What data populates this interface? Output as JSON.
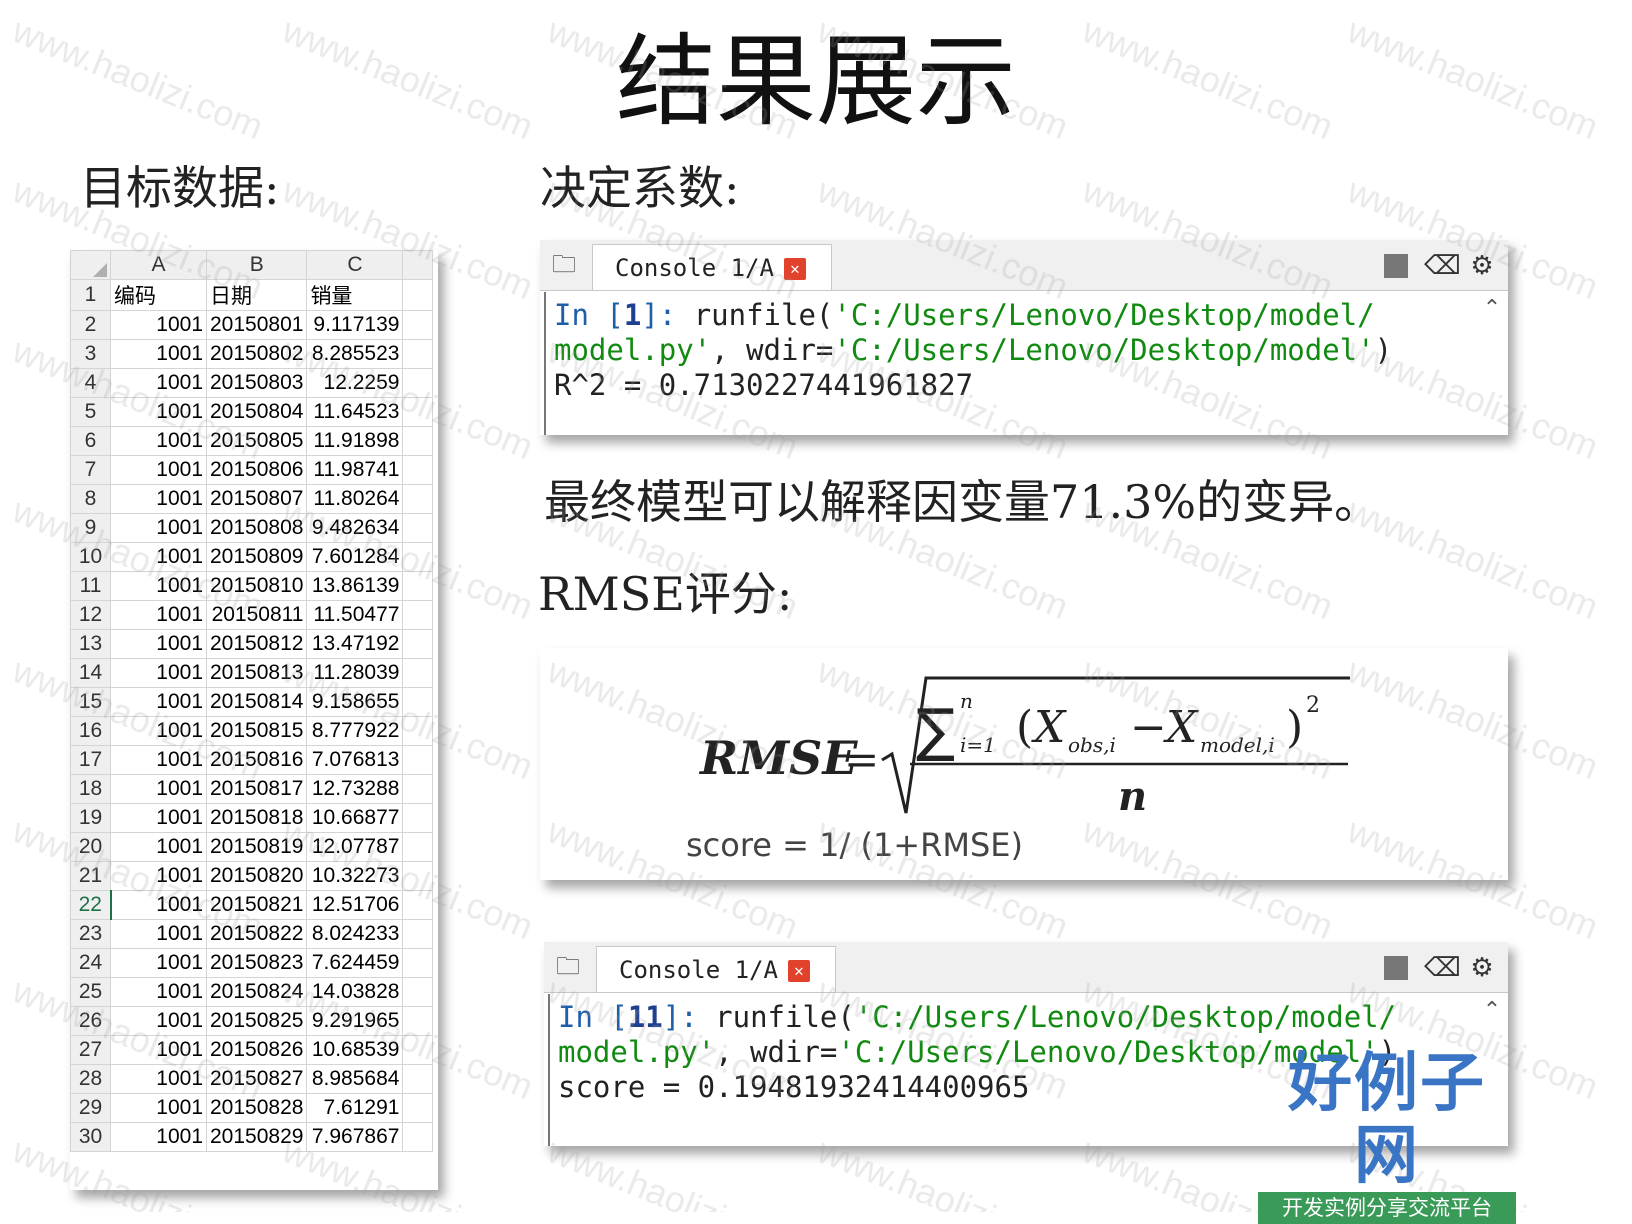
{
  "title": "结果展示",
  "headings": {
    "target_data": "目标数据:",
    "r2": "决定系数:",
    "explain": "最终模型可以解释因变量71.3%的变异。",
    "rmse": "RMSE评分:"
  },
  "sheet": {
    "col_headers": [
      "A",
      "B",
      "C"
    ],
    "header_row": [
      "编码",
      "日期",
      "销量"
    ],
    "selected_row": "22",
    "rows": [
      [
        "1001",
        "20150801",
        "9.117139"
      ],
      [
        "1001",
        "20150802",
        "8.285523"
      ],
      [
        "1001",
        "20150803",
        "12.2259"
      ],
      [
        "1001",
        "20150804",
        "11.64523"
      ],
      [
        "1001",
        "20150805",
        "11.91898"
      ],
      [
        "1001",
        "20150806",
        "11.98741"
      ],
      [
        "1001",
        "20150807",
        "11.80264"
      ],
      [
        "1001",
        "20150808",
        "9.482634"
      ],
      [
        "1001",
        "20150809",
        "7.601284"
      ],
      [
        "1001",
        "20150810",
        "13.86139"
      ],
      [
        "1001",
        "20150811",
        "11.50477"
      ],
      [
        "1001",
        "20150812",
        "13.47192"
      ],
      [
        "1001",
        "20150813",
        "11.28039"
      ],
      [
        "1001",
        "20150814",
        "9.158655"
      ],
      [
        "1001",
        "20150815",
        "8.777922"
      ],
      [
        "1001",
        "20150816",
        "7.076813"
      ],
      [
        "1001",
        "20150817",
        "12.73288"
      ],
      [
        "1001",
        "20150818",
        "10.66877"
      ],
      [
        "1001",
        "20150819",
        "12.07787"
      ],
      [
        "1001",
        "20150820",
        "10.32273"
      ],
      [
        "1001",
        "20150821",
        "12.51706"
      ],
      [
        "1001",
        "20150822",
        "8.024233"
      ],
      [
        "1001",
        "20150823",
        "7.624459"
      ],
      [
        "1001",
        "20150824",
        "14.03828"
      ],
      [
        "1001",
        "20150825",
        "9.291965"
      ],
      [
        "1001",
        "20150826",
        "10.68539"
      ],
      [
        "1001",
        "20150827",
        "8.985684"
      ],
      [
        "1001",
        "20150828",
        "7.61291"
      ],
      [
        "1001",
        "20150829",
        "7.967867"
      ]
    ]
  },
  "console1": {
    "tab_label": "Console 1/A",
    "prompt_in": "In [",
    "prompt_num": "1",
    "prompt_end": "]: ",
    "fn": "runfile(",
    "path1": "'C:/Users/Lenovo/Desktop/model/",
    "path2": "model.py'",
    "mid": ", wdir=",
    "dir": "'C:/Users/Lenovo/Desktop/model'",
    "close": ")",
    "result": "R^2 = 0.7130227441961827"
  },
  "console2": {
    "tab_label": "Console 1/A",
    "prompt_in": "In [",
    "prompt_num": "11",
    "prompt_end": "]: ",
    "fn": "runfile(",
    "path1": "'C:/Users/Lenovo/Desktop/model/",
    "path2": "model.py'",
    "mid": ", wdir=",
    "dir": "'C:/Users/Lenovo/Desktop/model'",
    "close": ")",
    "result": "score = 0.19481932414400965"
  },
  "formula": {
    "lhs": "RMSE",
    "eq": "=",
    "sum_upper": "n",
    "sum_lower": "i=1",
    "x_obs": "X",
    "obs_sub": "obs,i",
    "x_model": "X",
    "model_sub": "model,i",
    "power": "2",
    "denominator": "n",
    "score_line": "score = 1/ (1+RMSE)"
  },
  "logo": {
    "main": "好例子网",
    "sub": "开发实例分享交流平台"
  },
  "watermark": "www.haolizi.com",
  "colors": {
    "prompt_blue": "#1f5fa8",
    "string_green": "#118a11",
    "close_red": "#e0422b",
    "logo_blue": "#3a74c4",
    "logo_green": "#3a9a58"
  }
}
